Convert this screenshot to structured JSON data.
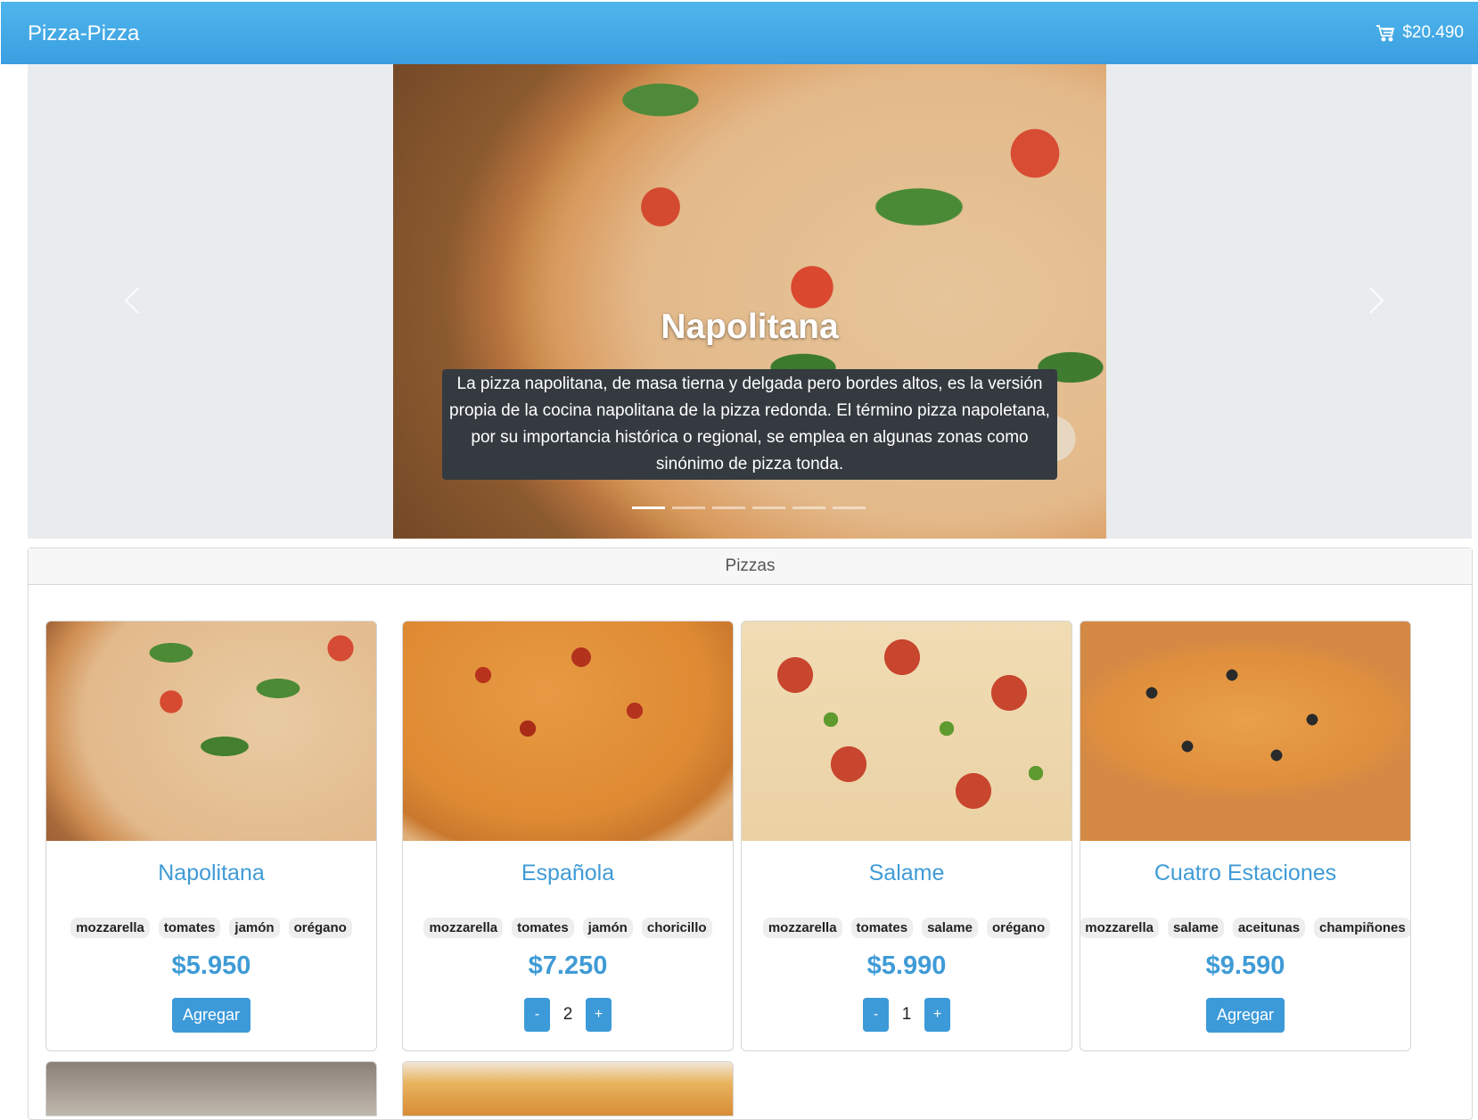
{
  "navbar": {
    "brand": "Pizza-Pizza",
    "cart_total": "$20.490"
  },
  "carousel": {
    "slide_title": "Napolitana",
    "slide_text": "La pizza napolitana, de masa tierna y delgada pero bordes altos, es la versión propia de la cocina napolitana de la pizza redonda. El término pizza napoletana, por su importancia histórica o regional, se emplea en algunas zonas como sinónimo de pizza tonda.",
    "indicator_count": 6,
    "active_indicator": 1
  },
  "section": {
    "title": "Pizzas"
  },
  "pizzas": [
    {
      "name": "Napolitana",
      "ingredients": [
        "mozzarella",
        "tomates",
        "jamón",
        "orégano"
      ],
      "price": "$5.950",
      "action": "Agregar"
    },
    {
      "name": "Española",
      "ingredients": [
        "mozzarella",
        "tomates",
        "jamón",
        "choricillo"
      ],
      "price": "$7.250",
      "quantity": "2",
      "minus": "-",
      "plus": "+"
    },
    {
      "name": "Salame",
      "ingredients": [
        "mozzarella",
        "tomates",
        "salame",
        "orégano"
      ],
      "price": "$5.990",
      "quantity": "1",
      "minus": "-",
      "plus": "+"
    },
    {
      "name": "Cuatro Estaciones",
      "ingredients": [
        "mozzarella",
        "salame",
        "aceitunas",
        "champiñones"
      ],
      "price": "$9.590",
      "action": "Agregar"
    }
  ]
}
